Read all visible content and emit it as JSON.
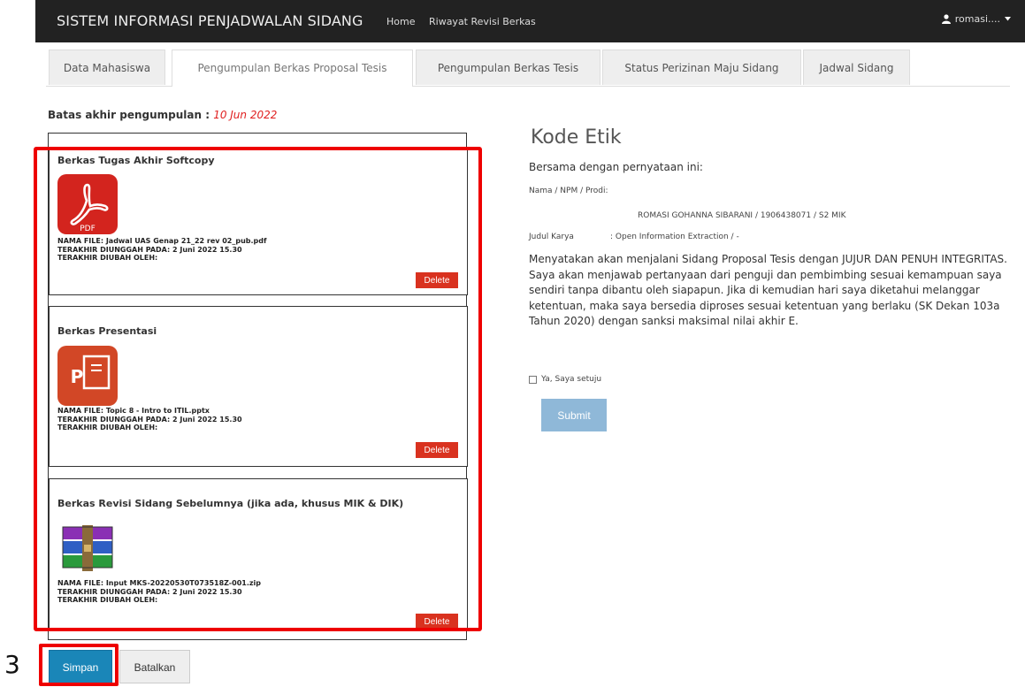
{
  "navbar": {
    "brand": "SISTEM INFORMASI PENJADWALAN SIDANG",
    "links": [
      "Home",
      "Riwayat Revisi Berkas"
    ],
    "user": "romasi...."
  },
  "tabs": [
    "Data Mahasiswa",
    "Pengumpulan Berkas Proposal Tesis",
    "Pengumpulan Berkas Tesis",
    "Status Perizinan Maju Sidang",
    "Jadwal Sidang"
  ],
  "deadline": {
    "label": "Batas akhir pengumpulan : ",
    "date": "10 Jun 2022"
  },
  "files": [
    {
      "title": "Berkas Tugas Akhir Softcopy",
      "icon": "pdf-icon",
      "nama_file": "NAMA FILE: Jadwal UAS Genap 21_22 rev 02_pub.pdf",
      "uploaded": "TERAKHIR DIUNGGAH PADA: 2 Juni 2022 15.30",
      "changed_by": "TERAKHIR DIUBAH OLEH:",
      "delete_label": "Delete"
    },
    {
      "title": "Berkas Presentasi",
      "icon": "powerpoint-icon",
      "nama_file": "NAMA FILE: Topic 8 - Intro to ITIL.pptx",
      "uploaded": "TERAKHIR DIUNGGAH PADA: 2 Juni 2022 15.30",
      "changed_by": "TERAKHIR DIUBAH OLEH:",
      "delete_label": "Delete"
    },
    {
      "title": "Berkas Revisi Sidang Sebelumnya (jika ada, khusus MIK & DIK)",
      "icon": "winrar-icon",
      "nama_file": "NAMA FILE: Input MKS-20220530T073518Z-001.zip",
      "uploaded": "TERAKHIR DIUNGGAH PADA: 2 Juni 2022 15.30",
      "changed_by": "TERAKHIR DIUBAH OLEH:",
      "delete_label": "Delete"
    }
  ],
  "buttons": {
    "simpan": "Simpan",
    "batalkan": "Batalkan"
  },
  "annotation": {
    "step": "3"
  },
  "kode_etik": {
    "title": "Kode Etik",
    "intro": "Bersama dengan pernyataan ini:",
    "nama_label": "Nama / NPM / Prodi:",
    "nama_value": "ROMASI GOHANNA SIBARANI / 1906438071 / S2 MIK",
    "judul_label": "Judul Karya",
    "judul_value": ": Open Information Extraction / -",
    "statement": "Menyatakan akan menjalani Sidang Proposal Tesis dengan JUJUR DAN PENUH INTEGRITAS. Saya akan menjawab pertanyaan dari penguji dan pembimbing sesuai kemampuan saya sendiri tanpa dibantu oleh siapapun. Jika di kemudian hari saya diketahui melanggar ketentuan, maka saya bersedia diproses sesuai ketentuan yang berlaku (SK Dekan 103a Tahun 2020) dengan sanksi maksimal nilai akhir E.",
    "agree_label": "Ya, Saya setuju",
    "submit_label": "Submit"
  },
  "colors": {
    "navbar": "#222222",
    "delete": "#d9321f",
    "primary": "#1a86b8",
    "submit_disabled": "#8fb8d8",
    "annotation": "#ee0000",
    "deadline": "#e02020"
  }
}
